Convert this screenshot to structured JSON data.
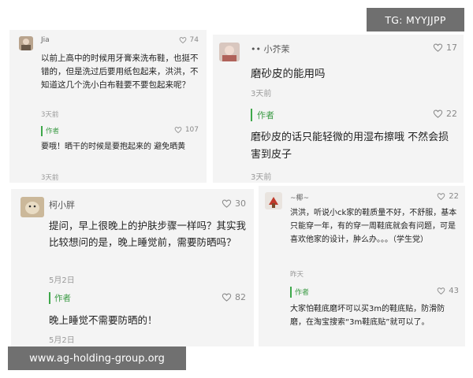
{
  "tg_label": "TG: MYYJJPP",
  "watermark": "www.ag-holding-group.org",
  "comments": [
    {
      "username": "Jia",
      "likes": "74",
      "text": "以前上高中的时候用牙膏来洗布鞋，也挺不错的，但是洗过后要用纸包起来，洪洪，不知道这几个洗小白布鞋要不要包起来呢？",
      "date": "3天前",
      "reply": {
        "author_label": "作者",
        "likes": "107",
        "text": "要哦！晒干的时候是要抱起来的 避免晒黄",
        "date": "3天前"
      }
    },
    {
      "username": "小芥茉",
      "username_prefix": "••",
      "likes": "17",
      "text": "磨砂皮的能用吗",
      "date": "3天前",
      "reply": {
        "author_label": "作者",
        "likes": "22",
        "text": "磨砂皮的话只能轻微的用湿布擦哦 不然会损害到皮子",
        "date": "3天前"
      }
    },
    {
      "username": "柯小胖",
      "likes": "30",
      "text": "提问，早上很晚上的护肤步骤一样吗？其实我比较想问的是，晚上睡觉前，需要防晒吗？",
      "date": "5月2日",
      "reply": {
        "author_label": "作者",
        "likes": "82",
        "text": "晚上睡觉不需要防晒的！",
        "date": "5月2日"
      }
    },
    {
      "username": "~椰~",
      "likes": "22",
      "text": "洪洪，听说小ck家的鞋质量不好，不舒服，基本只能穿一年，有的穿一周鞋底就会有问题，可是喜欢他家的设计，肿么办。。。（学生党）",
      "date": "昨天",
      "reply": {
        "author_label": "作者",
        "likes": "43",
        "text": "大家怕鞋底磨坏可以买3m的鞋底贴，防滑防磨，在淘宝搜索“3m鞋底贴”就可以了。"
      }
    }
  ],
  "colors": {
    "card_bg": "#f4f4f4",
    "author_green": "#3a9a44",
    "reply_bar": "#3ea84a",
    "overlay_bg": "#6f6f6f"
  },
  "icons": {
    "like": "heart-outline-icon"
  }
}
